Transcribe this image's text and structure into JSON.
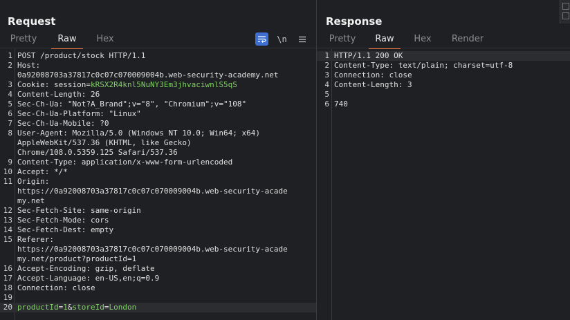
{
  "request": {
    "title": "Request",
    "tabs": [
      "Pretty",
      "Raw",
      "Hex"
    ],
    "active_tab": "Raw",
    "toolbar": {
      "wrap_icon": "wrap-lines-icon",
      "newline_label": "\\n",
      "menu_icon": "hamburger-menu-icon"
    },
    "lines": [
      {
        "n": "1",
        "parts": [
          {
            "t": "POST /product/stock HTTP/1.1"
          }
        ]
      },
      {
        "n": "2",
        "parts": [
          {
            "t": "Host:"
          }
        ]
      },
      {
        "n": "",
        "parts": [
          {
            "t": "0a92008703a37817c0c07c070009004b.web-security-academy.net"
          }
        ]
      },
      {
        "n": "3",
        "parts": [
          {
            "t": "Cookie: session="
          },
          {
            "t": "kRSX2R4knl5NuNY3Em3jhvaciwnlS5qS",
            "hl": true
          }
        ]
      },
      {
        "n": "4",
        "parts": [
          {
            "t": "Content-Length: 26"
          }
        ]
      },
      {
        "n": "5",
        "parts": [
          {
            "t": "Sec-Ch-Ua: \"Not?A_Brand\";v=\"8\", \"Chromium\";v=\"108\""
          }
        ]
      },
      {
        "n": "6",
        "parts": [
          {
            "t": "Sec-Ch-Ua-Platform: \"Linux\""
          }
        ]
      },
      {
        "n": "7",
        "parts": [
          {
            "t": "Sec-Ch-Ua-Mobile: ?0"
          }
        ]
      },
      {
        "n": "8",
        "parts": [
          {
            "t": "User-Agent: Mozilla/5.0 (Windows NT 10.0; Win64; x64)"
          }
        ]
      },
      {
        "n": "",
        "parts": [
          {
            "t": "AppleWebKit/537.36 (KHTML, like Gecko)"
          }
        ]
      },
      {
        "n": "",
        "parts": [
          {
            "t": "Chrome/108.0.5359.125 Safari/537.36"
          }
        ]
      },
      {
        "n": "9",
        "parts": [
          {
            "t": "Content-Type: application/x-www-form-urlencoded"
          }
        ]
      },
      {
        "n": "10",
        "parts": [
          {
            "t": "Accept: */*"
          }
        ]
      },
      {
        "n": "11",
        "parts": [
          {
            "t": "Origin:"
          }
        ]
      },
      {
        "n": "",
        "parts": [
          {
            "t": "https://0a92008703a37817c0c07c070009004b.web-security-acade"
          }
        ]
      },
      {
        "n": "",
        "parts": [
          {
            "t": "my.net"
          }
        ]
      },
      {
        "n": "12",
        "parts": [
          {
            "t": "Sec-Fetch-Site: same-origin"
          }
        ]
      },
      {
        "n": "13",
        "parts": [
          {
            "t": "Sec-Fetch-Mode: cors"
          }
        ]
      },
      {
        "n": "14",
        "parts": [
          {
            "t": "Sec-Fetch-Dest: empty"
          }
        ]
      },
      {
        "n": "15",
        "parts": [
          {
            "t": "Referer:"
          }
        ]
      },
      {
        "n": "",
        "parts": [
          {
            "t": "https://0a92008703a37817c0c07c070009004b.web-security-acade"
          }
        ]
      },
      {
        "n": "",
        "parts": [
          {
            "t": "my.net/product?productId=1"
          }
        ]
      },
      {
        "n": "16",
        "parts": [
          {
            "t": "Accept-Encoding: gzip, deflate"
          }
        ]
      },
      {
        "n": "17",
        "parts": [
          {
            "t": "Accept-Language: en-US,en;q=0.9"
          }
        ]
      },
      {
        "n": "18",
        "parts": [
          {
            "t": "Connection: close"
          }
        ]
      },
      {
        "n": "19",
        "parts": [
          {
            "t": ""
          }
        ]
      },
      {
        "n": "20",
        "cursor": true,
        "parts": [
          {
            "t": "productId",
            "hl": true
          },
          {
            "t": "="
          },
          {
            "t": "1",
            "hl": true
          },
          {
            "t": "&"
          },
          {
            "t": "storeId",
            "hl": true
          },
          {
            "t": "="
          },
          {
            "t": "London",
            "hl": true
          }
        ]
      }
    ]
  },
  "response": {
    "title": "Response",
    "tabs": [
      "Pretty",
      "Raw",
      "Hex",
      "Render"
    ],
    "active_tab": "Raw",
    "lines": [
      {
        "n": "1",
        "cursor": true,
        "parts": [
          {
            "t": "HTTP/1.1 200 OK"
          }
        ]
      },
      {
        "n": "2",
        "parts": [
          {
            "t": "Content-Type: text/plain; charset=utf-8"
          }
        ]
      },
      {
        "n": "3",
        "parts": [
          {
            "t": "Connection: close"
          }
        ]
      },
      {
        "n": "4",
        "parts": [
          {
            "t": "Content-Length: 3"
          }
        ]
      },
      {
        "n": "5",
        "parts": [
          {
            "t": ""
          }
        ]
      },
      {
        "n": "6",
        "parts": [
          {
            "t": "740"
          }
        ]
      }
    ]
  },
  "colors": {
    "accent": "#e8713c",
    "highlight": "#7fcf63",
    "background": "#1f2023",
    "toolbar_active": "#3e6fd1"
  }
}
